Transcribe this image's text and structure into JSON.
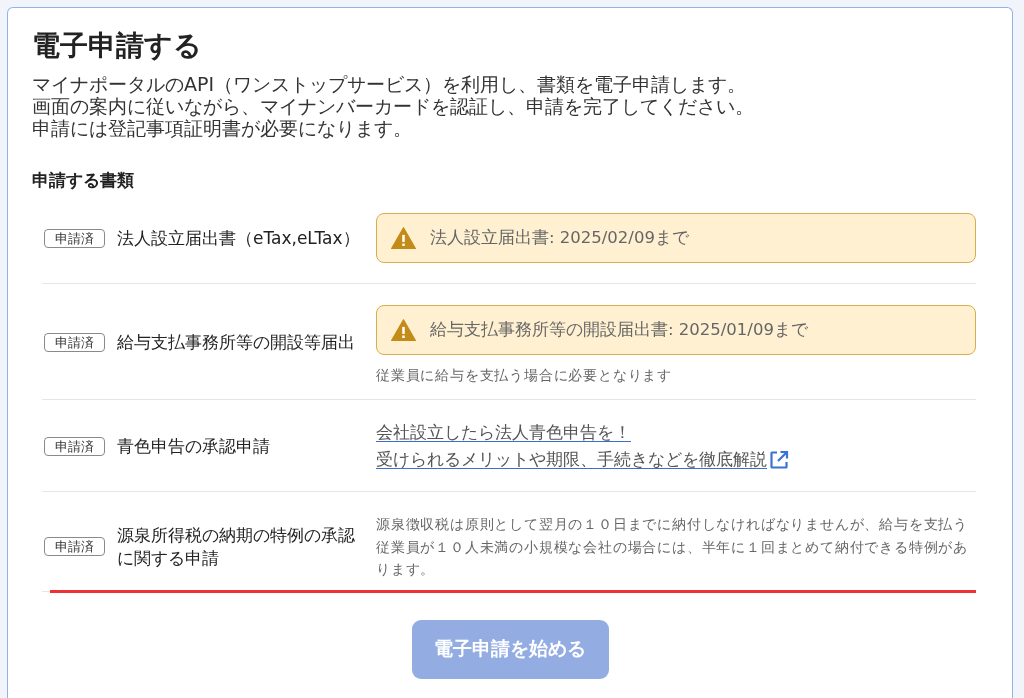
{
  "page": {
    "title": "電子申請する",
    "description": [
      "マイナポータルのAPI（ワンストップサービス）を利用し、書類を電子申請します。",
      "画面の案内に従いながら、マイナンバーカードを認証し、申請を完了してください。",
      "申請には登記事項証明書が必要になります。"
    ],
    "section_heading": "申請する書類"
  },
  "documents": [
    {
      "status": "申請済",
      "name": "法人設立届出書（eTax,eLTax）",
      "highlighted": false,
      "details": [
        {
          "kind": "alert",
          "text": "法人設立届出書: 2025/02/09まで"
        }
      ]
    },
    {
      "status": "申請済",
      "name": "給与支払事務所等の開設等届出",
      "highlighted": false,
      "details": [
        {
          "kind": "alert",
          "text": "給与支払事務所等の開設届出書: 2025/01/09まで"
        },
        {
          "kind": "note",
          "text": "従業員に給与を支払う場合に必要となります"
        }
      ]
    },
    {
      "status": "申請済",
      "name": "青色申告の承認申請",
      "highlighted": false,
      "details": [
        {
          "kind": "link",
          "text": "会社設立したら法人青色申告を！",
          "external": false
        },
        {
          "kind": "link",
          "text": "受けられるメリットや期限、手続きなどを徹底解説",
          "external": true
        }
      ]
    },
    {
      "status": "申請済",
      "name": "源泉所得税の納期の特例の承認に関する申請",
      "highlighted": true,
      "details": [
        {
          "kind": "note",
          "text": "源泉徴収税は原則として翌月の１０日までに納付しなければなりませんが、給与を支払う従業員が１０人未満の小規模な会社の場合には、半年に１回まとめて納付できる特例があります。"
        }
      ]
    }
  ],
  "start_button": {
    "label": "電子申請を始める",
    "disabled": true
  }
}
